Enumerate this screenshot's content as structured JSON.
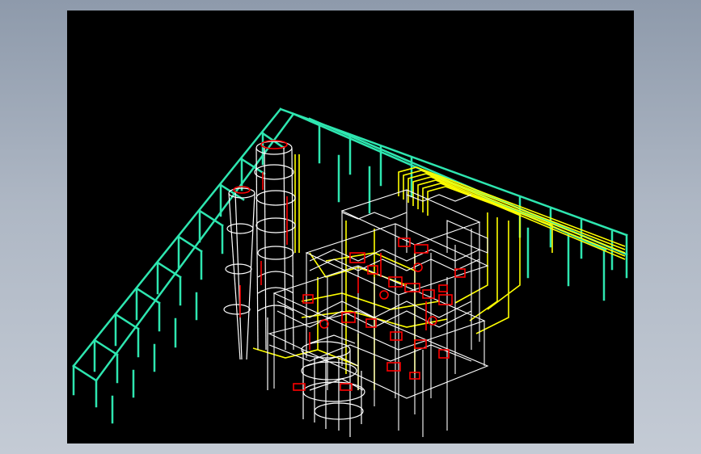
{
  "colors": {
    "page_bg_top": "#8e9aab",
    "page_bg_bottom": "#c4cbd5",
    "viewport_bg": "#000000",
    "pipe_rack": "#2ee6b0",
    "pipes": "#ffff00",
    "structure": "#ffffff",
    "equipment": "#ff0000"
  },
  "icons": [
    "pipe-rack-frame",
    "process-column",
    "steel-structure",
    "spiral-staircase",
    "equipment"
  ]
}
